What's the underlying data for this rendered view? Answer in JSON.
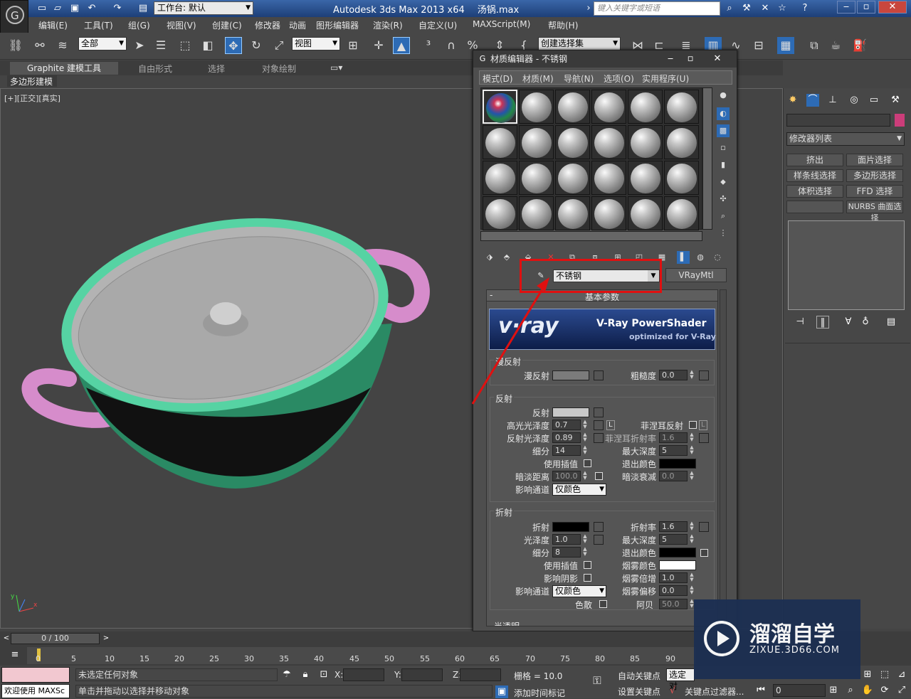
{
  "window": {
    "app_title": "Autodesk 3ds Max  2013 x64",
    "file_name": "汤锅.max",
    "workspace_label": "工作台: 默认",
    "search_placeholder": "键入关键字或短语"
  },
  "menu": {
    "items": [
      "编辑(E)",
      "工具(T)",
      "组(G)",
      "视图(V)",
      "创建(C)",
      "修改器",
      "动画",
      "图形编辑器",
      "渲染(R)",
      "自定义(U)",
      "MAXScript(M)",
      "帮助(H)"
    ]
  },
  "toolbar": {
    "selection_filter": "全部",
    "ref_coord": "视图",
    "named_selection": "创建选择集"
  },
  "ribbon": {
    "tabs": [
      "Graphite 建模工具",
      "自由形式",
      "选择",
      "对象绘制"
    ],
    "sub_tab": "多边形建模"
  },
  "viewport": {
    "label": "[+][正交][真实]"
  },
  "material_editor": {
    "title": "材质编辑器 - 不锈钢",
    "menu": [
      "模式(D)",
      "材质(M)",
      "导航(N)",
      "选项(O)",
      "实用程序(U)"
    ],
    "material_name": "不锈钢",
    "material_type": "VRayMtl",
    "rollout_title": "基本参数",
    "banner_brand": "v·ray",
    "banner_title": "V-Ray PowerShader",
    "banner_subtitle": "optimized for V-Ray",
    "diffuse_section": {
      "title": "漫反射",
      "diffuse_label": "漫反射",
      "roughness_label": "粗糙度",
      "roughness": "0.0"
    },
    "reflection_section": {
      "title": "反射",
      "reflect_label": "反射",
      "hilight_gloss_label": "高光光泽度",
      "hilight_gloss": "0.7",
      "refl_gloss_label": "反射光泽度",
      "refl_gloss": "0.89",
      "subdivs_label": "细分",
      "subdivs": "14",
      "use_interp_label": "使用插值",
      "dim_distance_label": "暗淡距离",
      "dim_distance": "100.0",
      "affect_channels_label": "影响通道",
      "affect_channels": "仅颜色",
      "fresnel_label": "菲涅耳反射",
      "fresnel_ior_label": "菲涅耳折射率",
      "fresnel_ior": "1.6",
      "max_depth_label": "最大深度",
      "max_depth": "5",
      "exit_color_label": "退出颜色",
      "dim_falloff_label": "暗淡衰减",
      "dim_falloff": "0.0",
      "lock_label": "L"
    },
    "refraction_section": {
      "title": "折射",
      "refract_label": "折射",
      "gloss_label": "光泽度",
      "gloss": "1.0",
      "subdivs_label": "细分",
      "subdivs": "8",
      "use_interp_label": "使用插值",
      "affect_shadows_label": "影响阴影",
      "affect_channels_label": "影响通道",
      "affect_channels": "仅颜色",
      "dispersion_label": "色散",
      "ior_label": "折射率",
      "ior": "1.6",
      "max_depth_label": "最大深度",
      "max_depth": "5",
      "exit_color_label": "退出颜色",
      "fog_color_label": "烟雾颜色",
      "fog_mult_label": "烟雾倍增",
      "fog_mult": "1.0",
      "fog_bias_label": "烟雾偏移",
      "fog_bias": "0.0",
      "abbe_label": "阿贝",
      "abbe": "50.0"
    },
    "next_section": "半透明"
  },
  "command_panel": {
    "modifier_list": "修改器列表",
    "buttons": [
      "挤出",
      "面片选择",
      "样条线选择",
      "多边形选择",
      "体积选择",
      "FFD 选择",
      "",
      "NURBS 曲面选择"
    ]
  },
  "timeline": {
    "frame_slider": "0 / 100",
    "ticks": [
      "0",
      "5",
      "10",
      "15",
      "20",
      "25",
      "30",
      "35",
      "40",
      "45",
      "50",
      "55",
      "60",
      "65",
      "70",
      "75",
      "80",
      "85",
      "90"
    ]
  },
  "status": {
    "welcome": "欢迎使用 MAXSc",
    "selection_status": "未选定任何对象",
    "prompt": "单击并拖动以选择并移动对象",
    "x_label": "X:",
    "y_label": "Y:",
    "z_label": "Z:",
    "grid": "栅格 = 10.0",
    "add_time_tag": "添加时间标记",
    "auto_key": "自动关键点",
    "set_key": "设置关键点",
    "selected": "选定对",
    "key_filters": "关键点过滤器...",
    "frame": "0"
  },
  "watermark": {
    "cn": "溜溜自学",
    "url": "ZIXUE.3D66.COM"
  },
  "colors": {
    "pot_body": "#4fcf9a",
    "handle": "#e89ad8",
    "lid": "#bcbcbc",
    "annotation": "#e01010"
  }
}
